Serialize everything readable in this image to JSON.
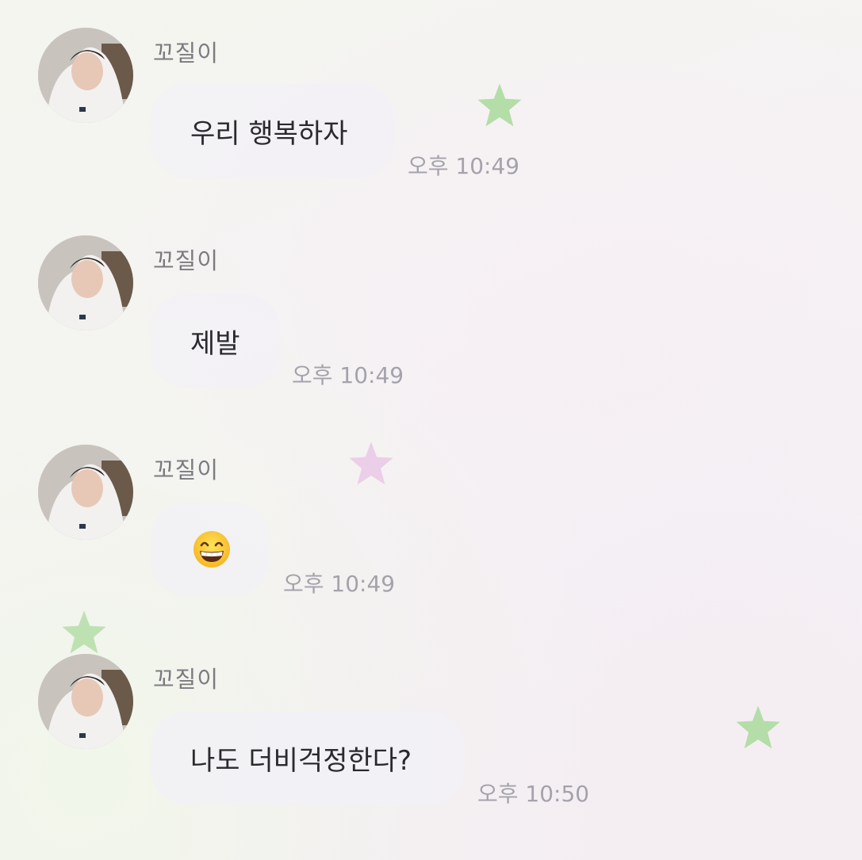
{
  "colors": {
    "bubble": "#f2f1f5",
    "sender_text": "#7b7b80",
    "time_text": "#a4a2ab",
    "star_green": "#a8d99a",
    "star_pink": "#e9c8e6"
  },
  "messages": [
    {
      "sender": "꼬질이",
      "text": "우리 행복하자",
      "time": "오후 10:49",
      "avatar_icon": "profile-photo"
    },
    {
      "sender": "꼬질이",
      "text": "제발",
      "time": "오후 10:49",
      "avatar_icon": "profile-photo"
    },
    {
      "sender": "꼬질이",
      "text": "",
      "emoji": "grinning-face-with-smiling-eyes",
      "time": "오후 10:49",
      "avatar_icon": "profile-photo"
    },
    {
      "sender": "꼬질이",
      "text": "나도 더비걱정한다?",
      "time": "오후 10:50",
      "avatar_icon": "profile-photo"
    }
  ],
  "decorations": [
    "green-star",
    "pink-star",
    "green-star",
    "green-star"
  ]
}
